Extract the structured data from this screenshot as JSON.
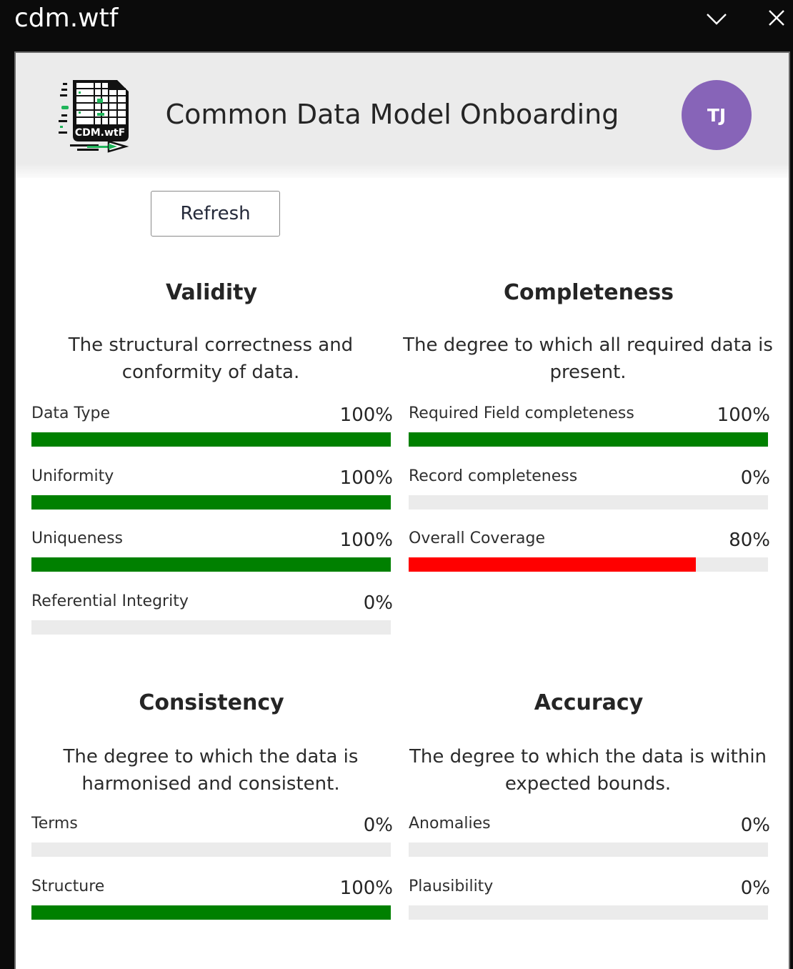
{
  "window": {
    "title": "cdm.wtf",
    "collapse_icon": "chevron-down-icon",
    "close_icon": "close-icon"
  },
  "header": {
    "logo_text": "CDM.wtF",
    "title": "Common Data Model Onboarding",
    "avatar_initials": "TJ",
    "avatar_color": "#8764b8"
  },
  "toolbar": {
    "refresh_label": "Refresh"
  },
  "colors": {
    "good": "#008000",
    "bad": "#ff0000",
    "track": "#ebebeb"
  },
  "sections": [
    {
      "title": "Validity",
      "description": "The structural correctness and conformity of data.",
      "metrics": [
        {
          "label": "Data Type",
          "value": "100%",
          "percent": 100,
          "status": "good"
        },
        {
          "label": "Uniformity",
          "value": "100%",
          "percent": 100,
          "status": "good"
        },
        {
          "label": "Uniqueness",
          "value": "100%",
          "percent": 100,
          "status": "good"
        },
        {
          "label": "Referential Integrity",
          "value": "0%",
          "percent": 0,
          "status": "good"
        }
      ]
    },
    {
      "title": "Completeness",
      "description": "The degree to which all required data is present.",
      "metrics": [
        {
          "label": "Required Field completeness",
          "value": "100%",
          "percent": 100,
          "status": "good"
        },
        {
          "label": "Record completeness",
          "value": "0%",
          "percent": 0,
          "status": "good"
        },
        {
          "label": "Overall Coverage",
          "value": "80%",
          "percent": 80,
          "status": "bad"
        }
      ]
    },
    {
      "title": "Consistency",
      "description": "The degree to which the data is harmonised and consistent.",
      "metrics": [
        {
          "label": "Terms",
          "value": "0%",
          "percent": 0,
          "status": "good"
        },
        {
          "label": "Structure",
          "value": "100%",
          "percent": 100,
          "status": "good"
        }
      ]
    },
    {
      "title": "Accuracy",
      "description": "The degree to which the data is within expected bounds.",
      "metrics": [
        {
          "label": "Anomalies",
          "value": "0%",
          "percent": 0,
          "status": "good"
        },
        {
          "label": "Plausibility",
          "value": "0%",
          "percent": 0,
          "status": "good"
        }
      ]
    }
  ]
}
